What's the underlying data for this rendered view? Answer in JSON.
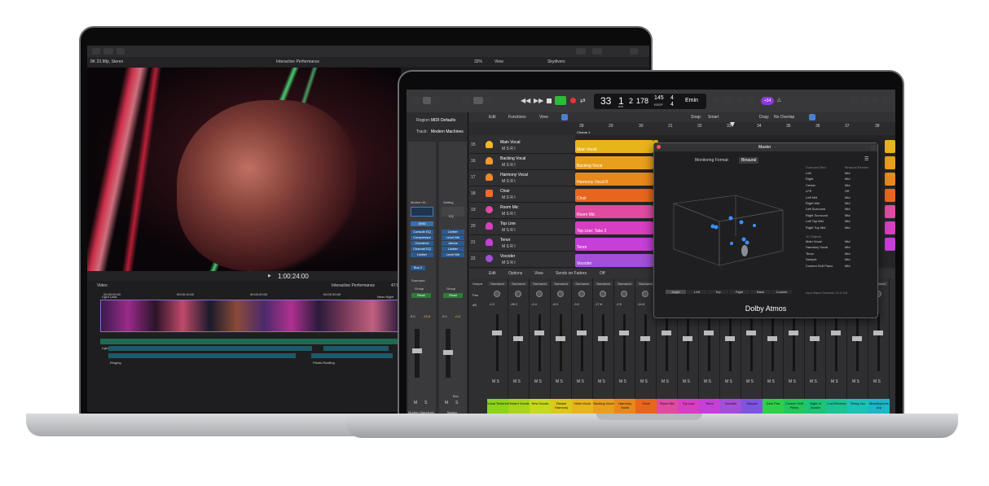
{
  "back": {
    "toolbar": {
      "format": "8K 23.98p, Stereo",
      "project": "Interactive Performance",
      "zoom": "32%",
      "view": "View",
      "library": "Skydivers"
    },
    "timecode": "1:00:24:00",
    "timeline": {
      "label": "Video",
      "title": "Interactive Performance",
      "dur": "47:0",
      "ruler": [
        "00:00:00:00",
        "00:00:10:00",
        "00:00:20:00",
        "00:00:30:00"
      ],
      "clip": "Neon Night",
      "clip2": "Light Leak"
    },
    "audio": [
      "Light of Life",
      "Shimmering Sound",
      "Ringing",
      "Water Ripples",
      "Plants Rustling"
    ]
  },
  "front": {
    "lcd": {
      "bar": "33",
      "beat": "1",
      "div": "2",
      "tick": "178",
      "bar_l": "BAR",
      "beat_l": "BEAT",
      "bpm": "145",
      "bpm_l": "KEEP",
      "sig_top": "4",
      "sig_bot": "4",
      "key": "Emin"
    },
    "badge": "+34",
    "inspector": {
      "region_l": "Region:",
      "region": "MIDI Defaults",
      "track_l": "Track:",
      "track": "Modern Machines",
      "patch": "Modern M...",
      "setting": "Setting",
      "eq": "EQ",
      "dmd": "DMD",
      "plugins": [
        "Console EQ",
        "Compressor",
        "Overdrive",
        "Channel EQ",
        "Limiter"
      ],
      "plugins2": [
        "Limiter",
        "Level Mtr",
        "Atmos",
        "Limiter",
        "Level Mtr"
      ],
      "bus": "Bus 2",
      "surround": "Surround",
      "group": "Group",
      "read": "Read",
      "vol": "0.0",
      "vol2": "-13.6",
      "vol3": "0.0",
      "vol4": "-0.4",
      "bounce": "Bnc",
      "m": "M",
      "s": "S",
      "name1": "Modern Machines",
      "name2": "Master"
    },
    "toolbar": {
      "edit": "Edit",
      "functions": "Functions",
      "view": "View",
      "snap_l": "Snap:",
      "snap": "Smart",
      "drag_l": "Drag:",
      "drag": "No Overlap"
    },
    "ruler": [
      "28",
      "29",
      "30",
      "31",
      "32",
      "33",
      "34",
      "35",
      "36",
      "37",
      "38"
    ],
    "marker": "Chorus 1",
    "tracks": [
      {
        "num": "15",
        "name": "Main Vocal"
      },
      {
        "num": "16",
        "name": "Backing Vocal"
      },
      {
        "num": "17",
        "name": "Harmony Vocal"
      },
      {
        "num": "18",
        "name": "Choir"
      },
      {
        "num": "19",
        "name": "Room Mic"
      },
      {
        "num": "20",
        "name": "Top Line"
      },
      {
        "num": "21",
        "name": "Tenor"
      },
      {
        "num": "22",
        "name": "Vocoder"
      }
    ],
    "regions": [
      "Main Vocal",
      "Backing Vocal",
      "Harmony Vocal 8",
      "Choir",
      "Room Mic",
      "Top Line: Take 2",
      "Tenor",
      "Vocoder"
    ],
    "mixer_bar": {
      "edit": "Edit",
      "options": "Options",
      "view": "View",
      "sends": "Sends on Faders",
      "off": "Off",
      "output_l": "Output",
      "surround": "Surround",
      "pan_l": "Pan",
      "db_l": "dB"
    },
    "master": {
      "title": "Master",
      "format_l": "Monitoring Format:",
      "format": "Binaural",
      "col1": "Surround Bed",
      "col2": "Binaural Render",
      "rows": [
        [
          "Left",
          "Mid"
        ],
        [
          "Right",
          "Mid"
        ],
        [
          "Center",
          "Mid"
        ],
        [
          "LFE",
          "Off"
        ],
        [
          "Left Mid",
          "Mid"
        ],
        [
          "Right Mid",
          "Mid"
        ],
        [
          "Left Surround",
          "Mid"
        ],
        [
          "Right Surround",
          "Mid"
        ],
        [
          "Left Top Mid",
          "Mid"
        ],
        [
          "Right Top Mid",
          "Mid"
        ]
      ],
      "objects_l": "10 Objects",
      "objects": [
        [
          "Main Vocal",
          "Mid"
        ],
        [
          "Harmony Vocal",
          "Mid"
        ],
        [
          "Tenor",
          "Mid"
        ],
        [
          "Sample",
          "Mid"
        ],
        [
          "Custom Soft Piano",
          "Mid"
        ]
      ],
      "views": [
        "Angle",
        "Left",
        "Top",
        "Right",
        "Back",
        "Custom"
      ],
      "footer": "Input Object Channels: 10 of 118",
      "brand": "Dolby Atmos"
    },
    "channels": [
      {
        "name": "Vocal Textures",
        "color": "#8bd419"
      },
      {
        "name": "Distant Vocals",
        "color": "#a8d41a"
      },
      {
        "name": "New Vocals",
        "color": "#c6d91b"
      },
      {
        "name": "Distant Harmony",
        "color": "#dcc71b"
      },
      {
        "name": "Main Vocal",
        "color": "#e8b41c"
      },
      {
        "name": "Backing Vocal",
        "color": "#e8a01c"
      },
      {
        "name": "Harmony Vocal",
        "color": "#e8881c"
      },
      {
        "name": "Choir",
        "color": "#e8661c"
      },
      {
        "name": "Room Mic",
        "color": "#e04aa0"
      },
      {
        "name": "Top Line",
        "color": "#d83ec2"
      },
      {
        "name": "Tenor",
        "color": "#c53fd8"
      },
      {
        "name": "Vocoder",
        "color": "#a34fd8"
      },
      {
        "name": "Sample",
        "color": "#7e55e0"
      },
      {
        "name": "Dark Pad",
        "color": "#2fcf4a"
      },
      {
        "name": "Custom Soft Piano",
        "color": "#22c75c"
      },
      {
        "name": "Night of Avalon",
        "color": "#1cc476"
      },
      {
        "name": "Lost Reverse",
        "color": "#1bc394"
      },
      {
        "name": "String Vox",
        "color": "#1bc2b5"
      },
      {
        "name": "Metallophone Arp",
        "color": "#1bb7c8"
      }
    ],
    "pan_values": [
      "-1.0",
      "-28.2",
      "-2.4",
      "-8.3",
      "-3.0",
      "-17.6",
      "-2.9",
      "-14.6",
      "-2.6",
      "-15.2",
      "-5.9",
      "-15.3",
      "-8.4",
      "-18.4",
      "-7.6"
    ]
  }
}
